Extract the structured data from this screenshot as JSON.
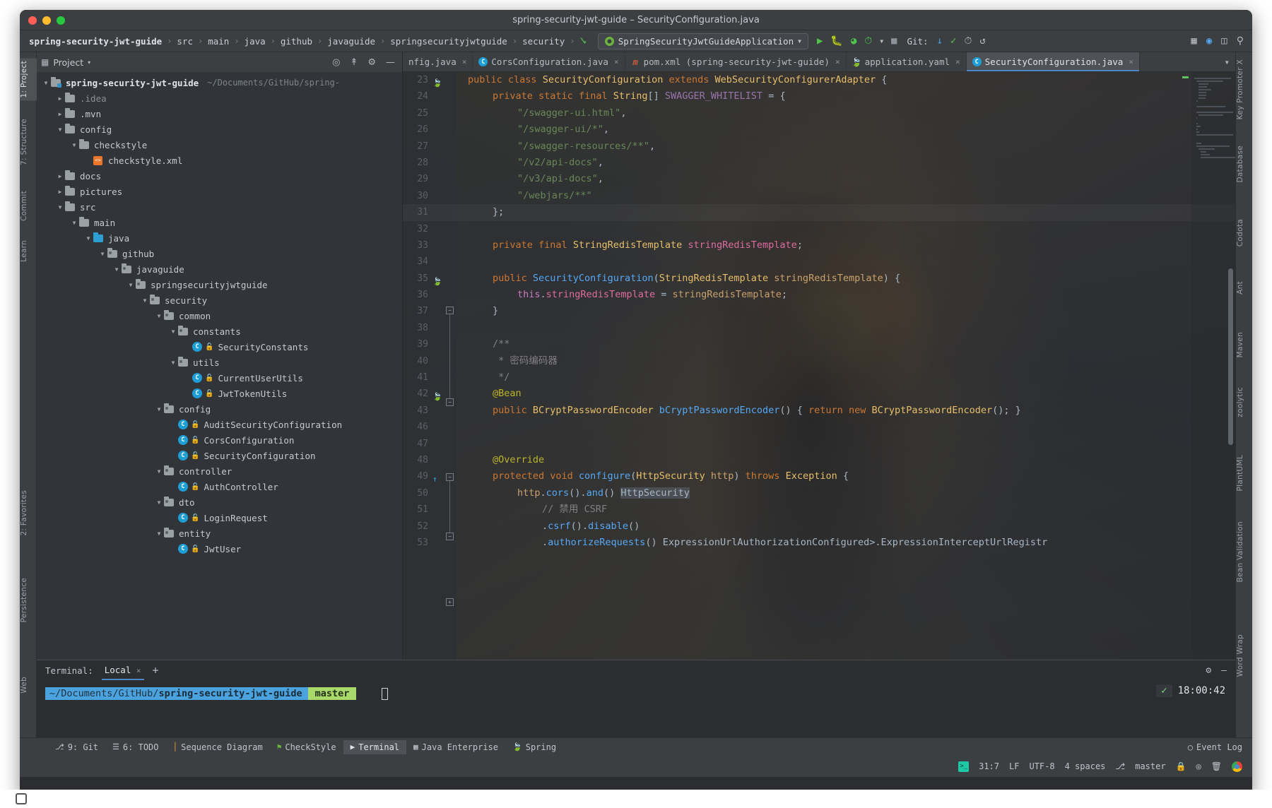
{
  "window": {
    "title": "spring-security-jwt-guide – SecurityConfiguration.java",
    "traffic": {
      "close": "close-window",
      "minimize": "minimize-window",
      "maximize": "maximize-window"
    }
  },
  "navbar": {
    "breadcrumbs": [
      "spring-security-jwt-guide",
      "src",
      "main",
      "java",
      "github",
      "javaguide",
      "springsecurityjwtguide",
      "security"
    ],
    "separator": "›",
    "run_config": "SpringSecurityJwtGuideApplication",
    "git_label": "Git:",
    "icons": {
      "run": "▶",
      "debug": "debug-icon",
      "coverage": "coverage-icon",
      "profile": "profile-icon",
      "stop": "■",
      "update": "↙",
      "commit": "✓",
      "history": "◴",
      "rollback": "↶",
      "search_everywhere": "⌕"
    }
  },
  "rail_left": [
    {
      "label": "1: Project",
      "selected": true
    },
    {
      "label": "7: Structure",
      "selected": false
    },
    {
      "label": "2: Favorites",
      "selected": false
    },
    {
      "label": "Commit",
      "selected": false
    },
    {
      "label": "Learn",
      "selected": false
    },
    {
      "label": "Persistence",
      "selected": false
    },
    {
      "label": "Web",
      "selected": false
    }
  ],
  "rail_right": [
    "Key Promoter X",
    "Database",
    "Codota",
    "Ant",
    "Maven",
    "zoolytic",
    "PlantUML",
    "Bean Validation",
    "Word Wrap"
  ],
  "project": {
    "header": "Project",
    "header_caret": "▾",
    "toolbar_icons": [
      "locate-icon",
      "collapse-all-icon",
      "settings-icon",
      "hide-icon"
    ],
    "tree": [
      {
        "depth": 0,
        "arrow": "down",
        "icon": "folder-module",
        "label": "spring-security-jwt-guide",
        "bold": true,
        "path": "~/Documents/GitHub/spring-"
      },
      {
        "depth": 1,
        "arrow": "right",
        "icon": "folder",
        "label": ".idea",
        "dim": true
      },
      {
        "depth": 1,
        "arrow": "right",
        "icon": "folder",
        "label": ".mvn"
      },
      {
        "depth": 1,
        "arrow": "down",
        "icon": "folder",
        "label": "config"
      },
      {
        "depth": 2,
        "arrow": "down",
        "icon": "folder",
        "label": "checkstyle"
      },
      {
        "depth": 3,
        "arrow": "none",
        "icon": "xml",
        "label": "checkstyle.xml"
      },
      {
        "depth": 1,
        "arrow": "right",
        "icon": "folder",
        "label": "docs"
      },
      {
        "depth": 1,
        "arrow": "right",
        "icon": "folder",
        "label": "pictures"
      },
      {
        "depth": 1,
        "arrow": "down",
        "icon": "folder",
        "label": "src"
      },
      {
        "depth": 2,
        "arrow": "down",
        "icon": "folder",
        "label": "main"
      },
      {
        "depth": 3,
        "arrow": "down",
        "icon": "folder-src",
        "label": "java"
      },
      {
        "depth": 4,
        "arrow": "down",
        "icon": "folder-pkg",
        "label": "github"
      },
      {
        "depth": 5,
        "arrow": "down",
        "icon": "folder-pkg",
        "label": "javaguide"
      },
      {
        "depth": 6,
        "arrow": "down",
        "icon": "folder-pkg",
        "label": "springsecurityjwtguide"
      },
      {
        "depth": 7,
        "arrow": "down",
        "icon": "folder-pkg",
        "label": "security"
      },
      {
        "depth": 8,
        "arrow": "down",
        "icon": "folder-pkg",
        "label": "common"
      },
      {
        "depth": 9,
        "arrow": "down",
        "icon": "folder-pkg",
        "label": "constants"
      },
      {
        "depth": 10,
        "arrow": "none",
        "icon": "class",
        "label": "SecurityConstants"
      },
      {
        "depth": 9,
        "arrow": "down",
        "icon": "folder-pkg",
        "label": "utils"
      },
      {
        "depth": 10,
        "arrow": "none",
        "icon": "class",
        "label": "CurrentUserUtils"
      },
      {
        "depth": 10,
        "arrow": "none",
        "icon": "class",
        "label": "JwtTokenUtils"
      },
      {
        "depth": 8,
        "arrow": "down",
        "icon": "folder-pkg",
        "label": "config"
      },
      {
        "depth": 9,
        "arrow": "none",
        "icon": "class",
        "label": "AuditSecurityConfiguration"
      },
      {
        "depth": 9,
        "arrow": "none",
        "icon": "class",
        "label": "CorsConfiguration"
      },
      {
        "depth": 9,
        "arrow": "none",
        "icon": "class",
        "label": "SecurityConfiguration"
      },
      {
        "depth": 8,
        "arrow": "down",
        "icon": "folder-pkg",
        "label": "controller"
      },
      {
        "depth": 9,
        "arrow": "none",
        "icon": "class",
        "label": "AuthController"
      },
      {
        "depth": 8,
        "arrow": "down",
        "icon": "folder-pkg",
        "label": "dto"
      },
      {
        "depth": 9,
        "arrow": "none",
        "icon": "class",
        "label": "LoginRequest"
      },
      {
        "depth": 8,
        "arrow": "down",
        "icon": "folder-pkg",
        "label": "entity"
      },
      {
        "depth": 9,
        "arrow": "none",
        "icon": "class",
        "label": "JwtUser"
      }
    ]
  },
  "editor": {
    "tabs": [
      {
        "label": "nfig.java",
        "icon": "java-class-icon",
        "active": false,
        "clipped": true
      },
      {
        "label": "CorsConfiguration.java",
        "icon": "java-class-icon",
        "active": false
      },
      {
        "label": "pom.xml (spring-security-jwt-guide)",
        "icon": "maven-icon",
        "active": false
      },
      {
        "label": "application.yaml",
        "icon": "spring-yaml-icon",
        "active": false
      },
      {
        "label": "SecurityConfiguration.java",
        "icon": "java-class-icon",
        "active": true
      }
    ],
    "close_glyph": "×",
    "lines": [
      {
        "n": 23,
        "indent": 0,
        "gutter": "spring-bean-icon",
        "tokens": [
          [
            "kw",
            "public "
          ],
          [
            "kw",
            "class "
          ],
          [
            "typ",
            "SecurityConfiguration "
          ],
          [
            "kw",
            "extends "
          ],
          [
            "typ",
            "WebSecurityConfigurerAdapter "
          ],
          [
            "brc",
            "{"
          ]
        ]
      },
      {
        "n": 24,
        "indent": 1,
        "tokens": [
          [
            "kw",
            "private "
          ],
          [
            "kw",
            "static "
          ],
          [
            "kw",
            "final "
          ],
          [
            "typ",
            "String"
          ],
          [
            "brc",
            "[] "
          ],
          [
            "fld",
            "SWAGGER_WHITELIST "
          ],
          [
            "brc",
            "= {"
          ]
        ]
      },
      {
        "n": 25,
        "indent": 2,
        "tokens": [
          [
            "str",
            "\"/swagger-ui.html\""
          ],
          [
            "brc",
            ","
          ]
        ]
      },
      {
        "n": 26,
        "indent": 2,
        "tokens": [
          [
            "str",
            "\"/swagger-ui/*\""
          ],
          [
            "brc",
            ","
          ]
        ]
      },
      {
        "n": 27,
        "indent": 2,
        "tokens": [
          [
            "str",
            "\"/swagger-resources/**\""
          ],
          [
            "brc",
            ","
          ]
        ]
      },
      {
        "n": 28,
        "indent": 2,
        "tokens": [
          [
            "str",
            "\"/v2/api-docs\""
          ],
          [
            "brc",
            ","
          ]
        ]
      },
      {
        "n": 29,
        "indent": 2,
        "tokens": [
          [
            "str",
            "\"/v3/api-docs\""
          ],
          [
            "brc",
            ","
          ]
        ]
      },
      {
        "n": 30,
        "indent": 2,
        "tokens": [
          [
            "str",
            "\"/webjars/**\""
          ]
        ]
      },
      {
        "n": 31,
        "indent": 1,
        "tokens": [
          [
            "brc",
            "};"
          ]
        ],
        "current": true
      },
      {
        "n": 32,
        "indent": 0,
        "tokens": []
      },
      {
        "n": 33,
        "indent": 1,
        "tokens": [
          [
            "kw",
            "private "
          ],
          [
            "kw",
            "final "
          ],
          [
            "typ",
            "StringRedisTemplate "
          ],
          [
            "pink",
            "stringRedisTemplate"
          ],
          [
            "brc",
            ";"
          ]
        ]
      },
      {
        "n": 34,
        "indent": 0,
        "tokens": []
      },
      {
        "n": 35,
        "indent": 1,
        "gutter": "override-arrow-icon",
        "tokens": [
          [
            "kw",
            "public "
          ],
          [
            "mth",
            "SecurityConfiguration"
          ],
          [
            "brc",
            "("
          ],
          [
            "typ",
            "StringRedisTemplate "
          ],
          [
            "par",
            "stringRedisTemplate"
          ],
          [
            "brc",
            ") {"
          ]
        ]
      },
      {
        "n": 36,
        "indent": 2,
        "tokens": [
          [
            "kw2",
            "this"
          ],
          [
            "brc",
            "."
          ],
          [
            "pink",
            "stringRedisTemplate "
          ],
          [
            "brc",
            "= "
          ],
          [
            "par",
            "stringRedisTemplate"
          ],
          [
            "brc",
            ";"
          ]
        ]
      },
      {
        "n": 37,
        "indent": 1,
        "tokens": [
          [
            "brc",
            "}"
          ]
        ]
      },
      {
        "n": 38,
        "indent": 0,
        "tokens": []
      },
      {
        "n": 39,
        "indent": 1,
        "tokens": [
          [
            "cmt",
            "/**"
          ]
        ]
      },
      {
        "n": 40,
        "indent": 1,
        "tokens": [
          [
            "cmt",
            " * 密码编码器"
          ]
        ]
      },
      {
        "n": 41,
        "indent": 1,
        "tokens": [
          [
            "cmt",
            " */"
          ]
        ]
      },
      {
        "n": 42,
        "indent": 1,
        "gutter": "bean-icon",
        "tokens": [
          [
            "ann",
            "@Bean"
          ]
        ]
      },
      {
        "n": 43,
        "indent": 1,
        "tokens": [
          [
            "kw",
            "public "
          ],
          [
            "typ",
            "BCryptPasswordEncoder "
          ],
          [
            "mth",
            "bCryptPasswordEncoder"
          ],
          [
            "brc",
            "() { "
          ],
          [
            "kw",
            "return "
          ],
          [
            "kw",
            "new "
          ],
          [
            "typ",
            "BCryptPasswordEncoder"
          ],
          [
            "brc",
            "(); }"
          ]
        ]
      },
      {
        "n": 46,
        "indent": 0,
        "tokens": []
      },
      {
        "n": 47,
        "indent": 0,
        "tokens": []
      },
      {
        "n": 48,
        "indent": 1,
        "tokens": [
          [
            "ann",
            "@Override"
          ]
        ]
      },
      {
        "n": 49,
        "indent": 1,
        "gutter": "override-method-icon",
        "tokens": [
          [
            "kw",
            "protected "
          ],
          [
            "kw",
            "void "
          ],
          [
            "mth",
            "configure"
          ],
          [
            "brc",
            "("
          ],
          [
            "typ",
            "HttpSecurity "
          ],
          [
            "par",
            "http"
          ],
          [
            "brc",
            ") "
          ],
          [
            "kw",
            "throws "
          ],
          [
            "typ",
            "Exception "
          ],
          [
            "brc",
            "{"
          ]
        ]
      },
      {
        "n": 50,
        "indent": 2,
        "tokens": [
          [
            "par",
            "http"
          ],
          [
            "brc",
            "."
          ],
          [
            "mth",
            "cors"
          ],
          [
            "brc",
            "()."
          ],
          [
            "mth",
            "and"
          ],
          [
            "brc",
            "() "
          ],
          [
            "sel",
            "HttpSecurity"
          ]
        ]
      },
      {
        "n": 51,
        "indent": 3,
        "tokens": [
          [
            "cmt",
            "// 禁用 CSRF"
          ]
        ]
      },
      {
        "n": 52,
        "indent": 3,
        "tokens": [
          [
            "brc",
            "."
          ],
          [
            "mth",
            "csrf"
          ],
          [
            "brc",
            "()."
          ],
          [
            "mth",
            "disable"
          ],
          [
            "brc",
            "()"
          ]
        ]
      },
      {
        "n": 53,
        "indent": 3,
        "tokens": [
          [
            "brc",
            "."
          ],
          [
            "mth",
            "authorizeRequests"
          ],
          [
            "brc",
            "() ExpressionUrlAuthorizationConfigured>.ExpressionInterceptUrlRegistr"
          ]
        ]
      }
    ]
  },
  "terminal": {
    "label": "Terminal:",
    "tab": "Local",
    "close_glyph": "×",
    "add_glyph": "+",
    "settings_icon": "gear-icon",
    "hide_icon": "minimize-icon",
    "prompt_path_prefix": "~/Documents/GitHub/",
    "prompt_path_bold": "spring-security-jwt-guide",
    "branch": "master",
    "clock": "18:00:42",
    "check_glyph": "✓"
  },
  "bottombar": {
    "items": [
      {
        "label": "9: Git",
        "icon": "git-branch-icon",
        "active": false
      },
      {
        "label": "6: TODO",
        "icon": "todo-list-icon",
        "active": false
      },
      {
        "label": "Sequence Diagram",
        "icon": "sequence-icon",
        "active": false
      },
      {
        "label": "CheckStyle",
        "icon": "checkstyle-icon",
        "active": false
      },
      {
        "label": "Terminal",
        "icon": "terminal-icon",
        "active": true
      },
      {
        "label": "Java Enterprise",
        "icon": "java-ee-icon",
        "active": false
      },
      {
        "label": "Spring",
        "icon": "spring-leaf-icon",
        "active": false
      }
    ],
    "event_log": "Event Log",
    "event_log_icon": "event-log-icon"
  },
  "statusbar": {
    "caret": "31:7",
    "line_sep": "LF",
    "encoding": "UTF-8",
    "indent": "4 spaces",
    "branch": "master",
    "branch_icon": "git-branch-icon",
    "terminal_icon": "terminal-green-icon",
    "lock_icon": "lock-icon",
    "inspect_icon": "inspection-icon",
    "trash_icon": "trash-icon",
    "browser_icon": "chrome-icon"
  },
  "colors": {
    "accent": "#4a88c7",
    "green": "#6db33f",
    "panel": "#3c3f41",
    "editor_bg": "#2b2d30",
    "tree_bg": "#313438",
    "string": "#6a8759",
    "keyword": "#cc7832",
    "type": "#e8bf6a",
    "method": "#56a8f5",
    "annotation": "#bbb529",
    "comment": "#808080"
  }
}
